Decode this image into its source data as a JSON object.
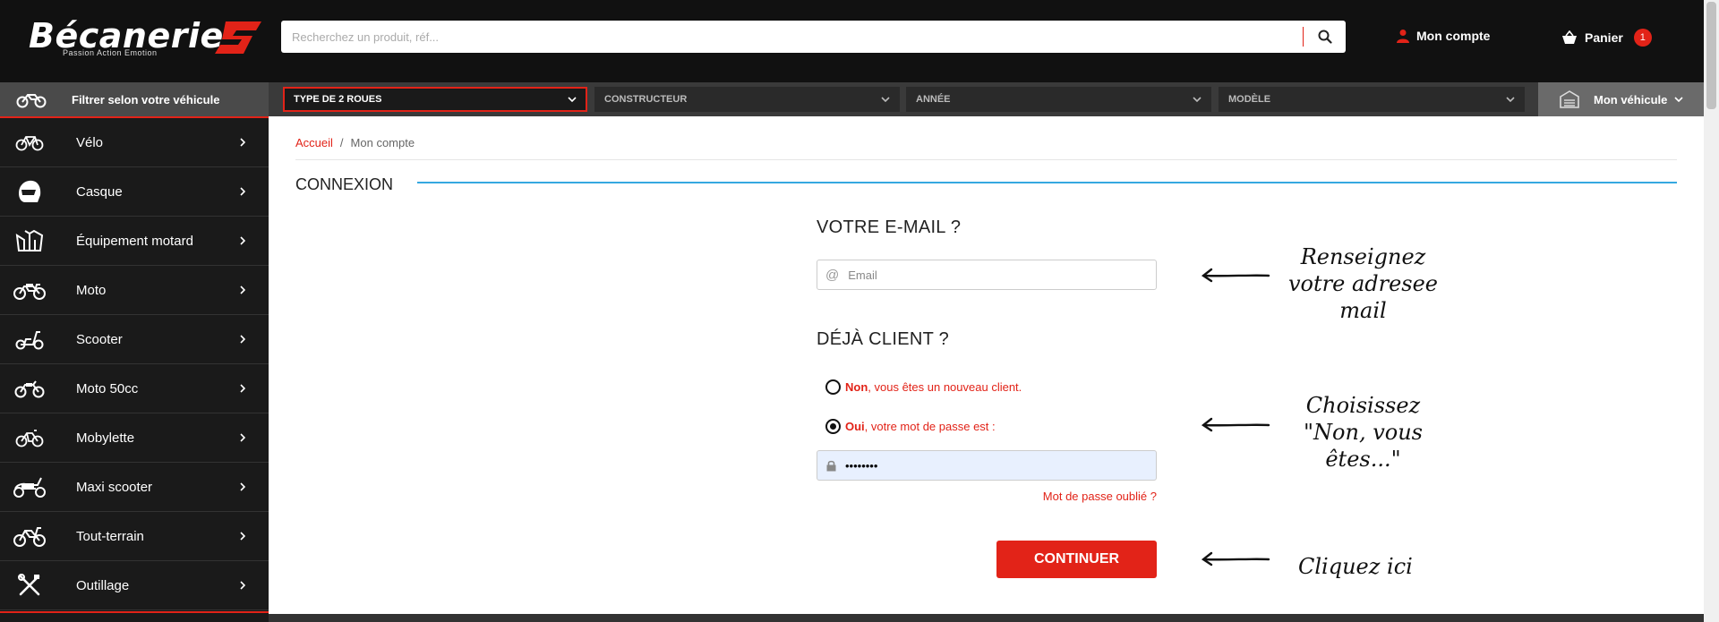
{
  "header": {
    "logo_text": "Bécanerie",
    "logo_tagline": "Passion Action Emotion",
    "search_placeholder": "Recherchez un produit, réf...",
    "account_label": "Mon compte",
    "cart_label": "Panier",
    "cart_count": "1"
  },
  "filterbar": {
    "label": "Filtrer selon votre véhicule",
    "selects": [
      "TYPE DE 2 ROUES",
      "CONSTRUCTEUR",
      "ANNÉE",
      "MODÈLE"
    ],
    "my_vehicle": "Mon véhicule"
  },
  "sidebar": {
    "items": [
      {
        "label": "Vélo",
        "icon": "bicycle-icon"
      },
      {
        "label": "Casque",
        "icon": "helmet-icon"
      },
      {
        "label": "Équipement motard",
        "icon": "jacket-icon"
      },
      {
        "label": "Moto",
        "icon": "motorcycle-icon"
      },
      {
        "label": "Scooter",
        "icon": "scooter-icon"
      },
      {
        "label": "Moto 50cc",
        "icon": "motorcycle-50cc-icon"
      },
      {
        "label": "Mobylette",
        "icon": "moped-icon"
      },
      {
        "label": "Maxi scooter",
        "icon": "maxi-scooter-icon"
      },
      {
        "label": "Tout-terrain",
        "icon": "dirt-bike-icon"
      },
      {
        "label": "Outillage",
        "icon": "tools-icon"
      }
    ]
  },
  "breadcrumb": {
    "home": "Accueil",
    "separator": "/",
    "current": "Mon compte"
  },
  "login": {
    "section_title": "CONNEXION",
    "email_question": "VOTRE E-MAIL ?",
    "email_placeholder": "Email",
    "client_question": "DÉJÀ CLIENT ?",
    "option_new_bold": "Non",
    "option_new_text": ", vous êtes un nouveau client.",
    "option_existing_bold": "Oui",
    "option_existing_text": ", votre mot de passe est :",
    "password_value": "••••••••",
    "forgot_link": "Mot de passe oublié ?",
    "continue_button": "CONTINUER"
  },
  "annotations": {
    "hint1_line1": "Renseignez",
    "hint1_line2": "votre adresee mail",
    "hint2_line1": "Choisissez",
    "hint2_line2": "\"Non, vous êtes...\"",
    "hint3": "Cliquez ici"
  },
  "colors": {
    "accent": "#e22318",
    "header_bg": "#111111",
    "section_line": "#35a8e0"
  }
}
